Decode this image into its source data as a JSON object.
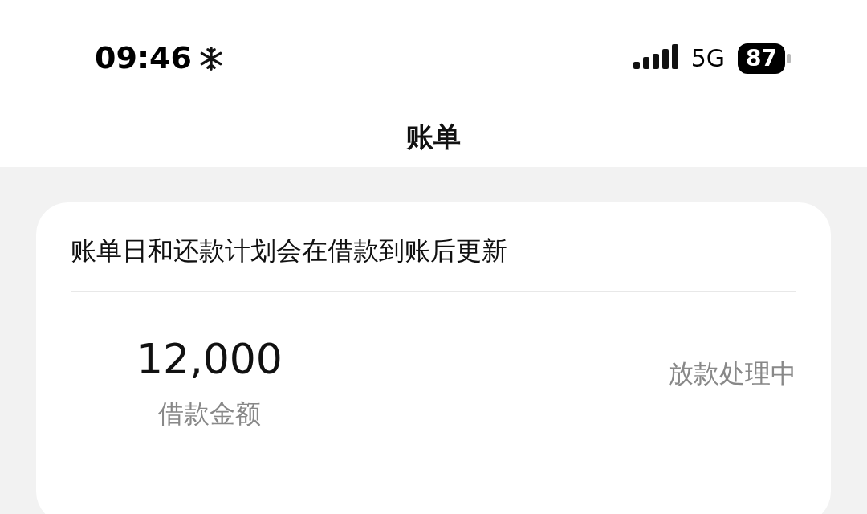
{
  "status_bar": {
    "time": "09:46",
    "network": "5G",
    "battery": "87"
  },
  "title": "账单",
  "card": {
    "notice": "账单日和还款计划会在借款到账后更新",
    "amount": "12,000",
    "amount_label": "借款金额",
    "status": "放款处理中"
  }
}
